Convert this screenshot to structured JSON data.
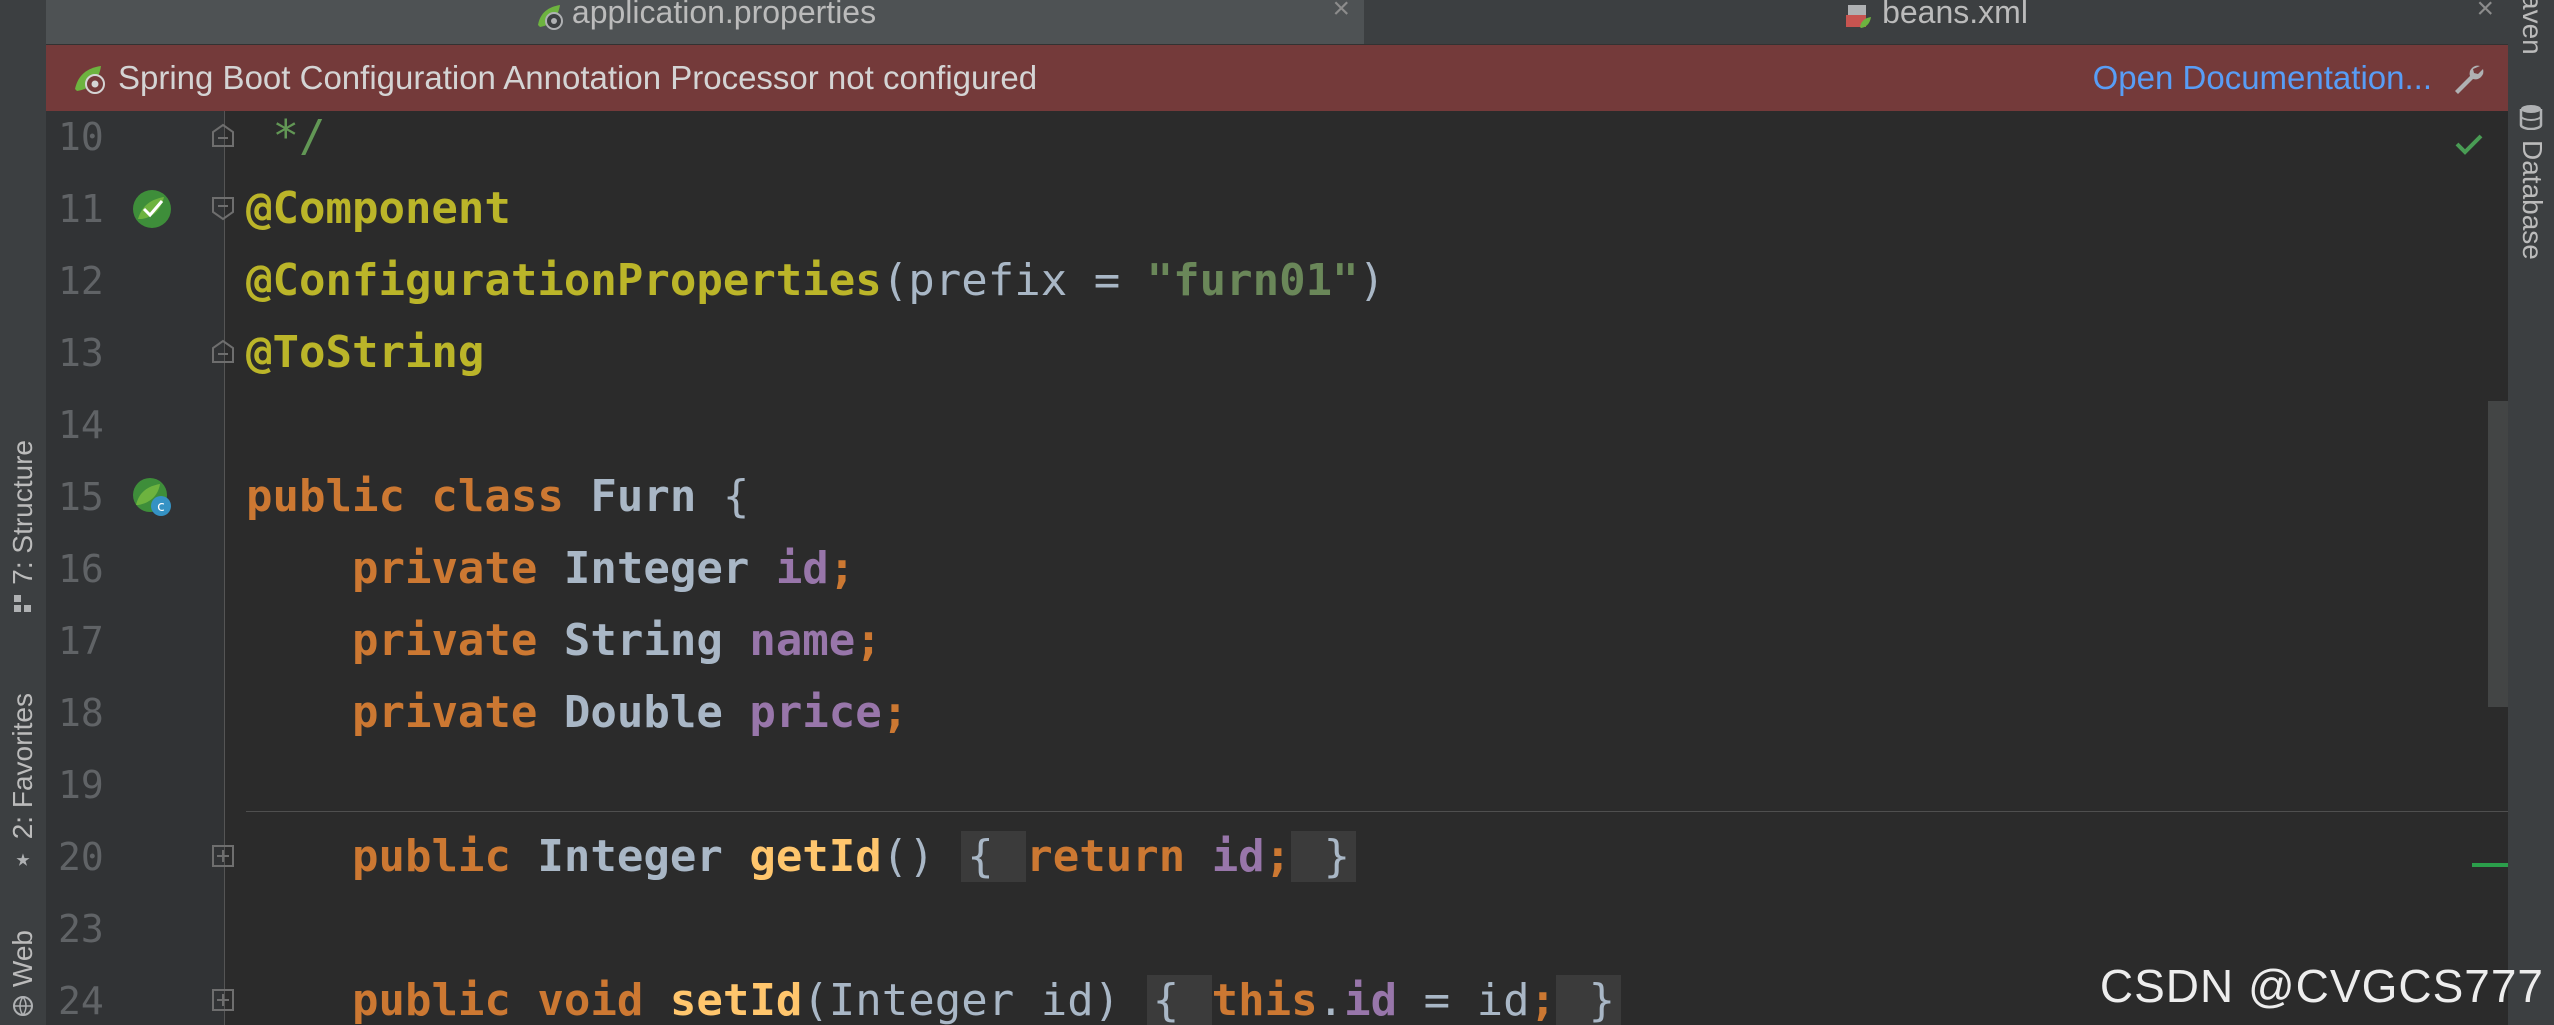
{
  "tabs": [
    {
      "label": "application.properties",
      "icon": "spring-properties-icon",
      "active": false
    },
    {
      "label": "beans.xml",
      "icon": "spring-xml-icon",
      "active": false
    }
  ],
  "banner": {
    "message": "Spring Boot Configuration Annotation Processor not configured",
    "link": "Open Documentation...",
    "background": "#743A3A",
    "link_color": "#589DF6"
  },
  "left_toolbar": {
    "structure": "7: Structure",
    "favorites": "2: Favorites",
    "web": "Web"
  },
  "right_toolbar": {
    "maven": "aven",
    "database": "Database"
  },
  "editor": {
    "lines": [
      {
        "num": "10",
        "fold": "up",
        "gutter_icon": "",
        "tokens": [
          {
            "c": "cmt",
            "t": " */"
          }
        ]
      },
      {
        "num": "11",
        "fold": "down",
        "gutter_icon": "spring-bean-check-icon",
        "tokens": [
          {
            "c": "ann",
            "t": "@Component"
          }
        ]
      },
      {
        "num": "12",
        "fold": "",
        "gutter_icon": "",
        "tokens": [
          {
            "c": "ann",
            "t": "@ConfigurationProperties"
          },
          {
            "c": "",
            "t": "(prefix = "
          },
          {
            "c": "str",
            "t": "\"furn01\""
          },
          {
            "c": "",
            "t": ")"
          }
        ]
      },
      {
        "num": "13",
        "fold": "up",
        "gutter_icon": "",
        "tokens": [
          {
            "c": "ann",
            "t": "@ToString"
          }
        ]
      },
      {
        "num": "14",
        "fold": "",
        "gutter_icon": "",
        "tokens": []
      },
      {
        "num": "15",
        "fold": "",
        "gutter_icon": "spring-bean-class-icon",
        "tokens": [
          {
            "c": "kw",
            "t": "public class "
          },
          {
            "c": "ty",
            "t": "Furn "
          },
          {
            "c": "",
            "t": "{"
          }
        ]
      },
      {
        "num": "16",
        "fold": "",
        "gutter_icon": "",
        "tokens": [
          {
            "c": "",
            "t": "    "
          },
          {
            "c": "kw",
            "t": "private "
          },
          {
            "c": "ty",
            "t": "Integer "
          },
          {
            "c": "fld",
            "t": "id"
          },
          {
            "c": "kw",
            "t": ";"
          }
        ]
      },
      {
        "num": "17",
        "fold": "",
        "gutter_icon": "",
        "tokens": [
          {
            "c": "",
            "t": "    "
          },
          {
            "c": "kw",
            "t": "private "
          },
          {
            "c": "ty",
            "t": "String "
          },
          {
            "c": "fld",
            "t": "name"
          },
          {
            "c": "kw",
            "t": ";"
          }
        ]
      },
      {
        "num": "18",
        "fold": "",
        "gutter_icon": "",
        "tokens": [
          {
            "c": "",
            "t": "    "
          },
          {
            "c": "kw",
            "t": "private "
          },
          {
            "c": "ty",
            "t": "Double "
          },
          {
            "c": "fld",
            "t": "price"
          },
          {
            "c": "kw",
            "t": ";"
          }
        ]
      },
      {
        "num": "19",
        "fold": "",
        "gutter_icon": "",
        "tokens": []
      },
      {
        "num": "20",
        "fold": "plus",
        "gutter_icon": "",
        "tokens": [
          {
            "c": "",
            "t": "    "
          },
          {
            "c": "kw",
            "t": "public "
          },
          {
            "c": "ty",
            "t": "Integer "
          },
          {
            "c": "fn",
            "t": "getId"
          },
          {
            "c": "",
            "t": "() "
          },
          {
            "c": "fb",
            "t": "{ "
          },
          {
            "c": "kw",
            "t": "return "
          },
          {
            "c": "fld",
            "t": "id"
          },
          {
            "c": "kw",
            "t": ";"
          },
          {
            "c": "fb",
            "t": " }"
          }
        ]
      },
      {
        "num": "23",
        "fold": "",
        "gutter_icon": "",
        "tokens": []
      },
      {
        "num": "24",
        "fold": "plus",
        "gutter_icon": "",
        "tokens": [
          {
            "c": "",
            "t": "    "
          },
          {
            "c": "kw",
            "t": "public void "
          },
          {
            "c": "fn",
            "t": "setId"
          },
          {
            "c": "",
            "t": "(Integer id) "
          },
          {
            "c": "fb",
            "t": "{ "
          },
          {
            "c": "kw",
            "t": "this"
          },
          {
            "c": "",
            "t": "."
          },
          {
            "c": "fld",
            "t": "id"
          },
          {
            "c": "",
            "t": " = id"
          },
          {
            "c": "kw",
            "t": ";"
          },
          {
            "c": "fb",
            "t": " }"
          }
        ]
      }
    ]
  },
  "watermark": "CSDN @CVGCS777",
  "colors": {
    "editor_bg": "#2B2B2B",
    "keyword": "#CC7832",
    "annotation": "#BBB529",
    "field": "#9876AA",
    "string": "#6A8759",
    "method": "#FFC66D"
  }
}
